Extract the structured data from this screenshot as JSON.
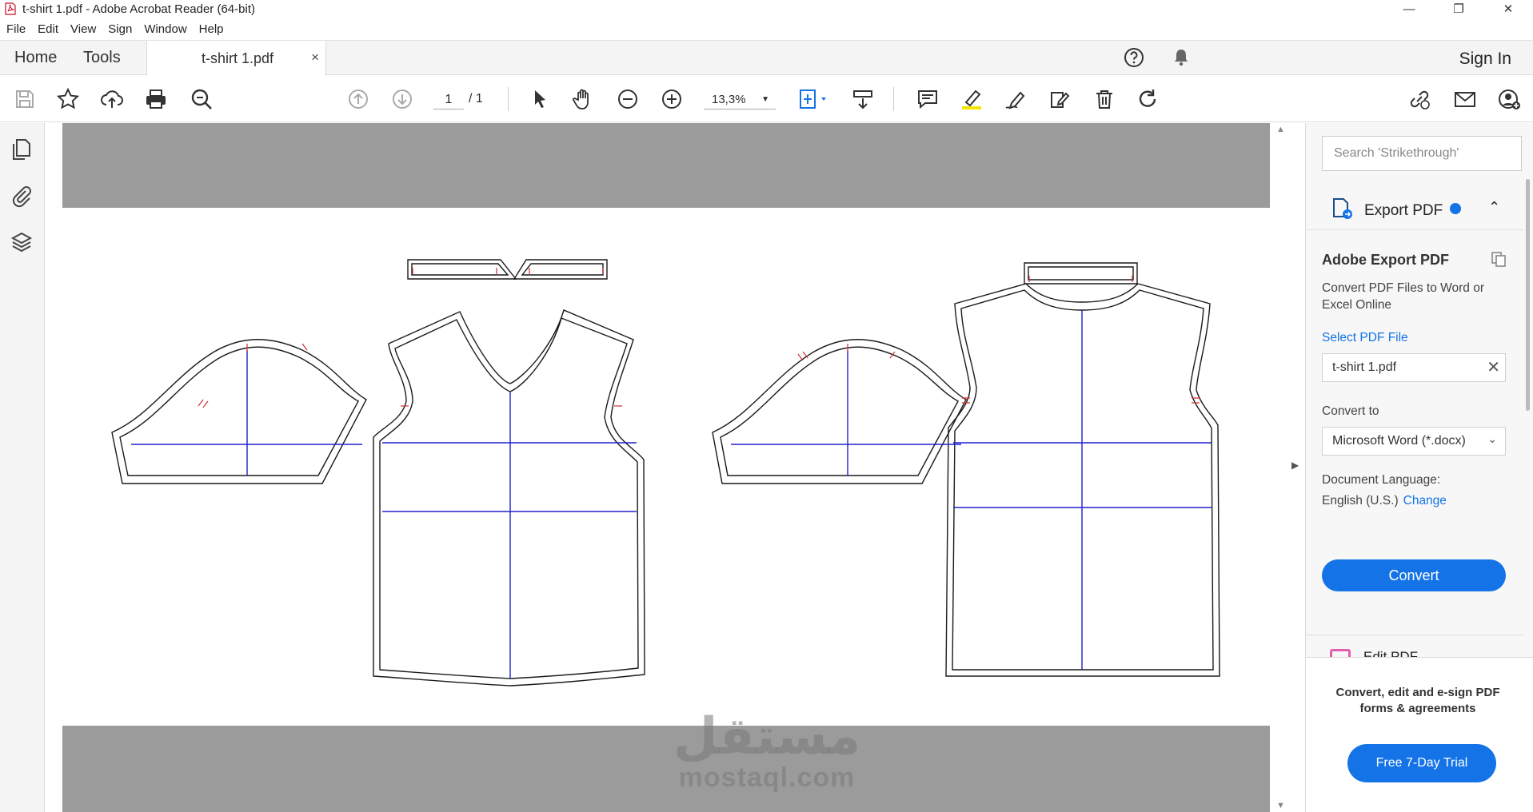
{
  "window": {
    "title": "t-shirt 1.pdf - Adobe Acrobat Reader (64-bit)",
    "controls": [
      "—",
      "❐",
      "✕"
    ]
  },
  "menu": [
    "File",
    "Edit",
    "View",
    "Sign",
    "Window",
    "Help"
  ],
  "tabs": {
    "home": "Home",
    "tools": "Tools",
    "document": "t-shirt 1.pdf",
    "close": "×",
    "sign_in": "Sign In"
  },
  "toolbar": {
    "page_current": "1",
    "page_total": "/ 1",
    "zoom": "13,3%",
    "zoom_caret": "▼"
  },
  "document": {
    "watermark_ar": "مستقل",
    "watermark_en": "mostaql.com",
    "pattern_line_color": "#1a1a1a",
    "grain_line_color": "#2020cc",
    "notch_color": "#d03030"
  },
  "right_panel": {
    "search_placeholder": "Search 'Strikethrough'",
    "export_title": "Export PDF",
    "export_chevron": "⌃",
    "heading": "Adobe Export PDF",
    "description": "Convert PDF Files to Word or Excel Online",
    "select_link": "Select PDF File",
    "file_name": "t-shirt 1.pdf",
    "file_clear": "✕",
    "convert_to_label": "Convert to",
    "convert_to_value": "Microsoft Word (*.docx)",
    "dropdown_caret": "⌄",
    "language_label": "Document Language:",
    "language_value": "English (U.S.)",
    "language_change": "Change",
    "convert_button": "Convert",
    "next_tool": "Edit PDF",
    "promo": "Convert, edit and e-sign PDF forms & agreements",
    "trial_button": "Free 7-Day Trial"
  },
  "colors": {
    "accent": "#1473e6",
    "chrome_bg": "#f4f4f4",
    "doc_gray": "#9b9b9b"
  }
}
